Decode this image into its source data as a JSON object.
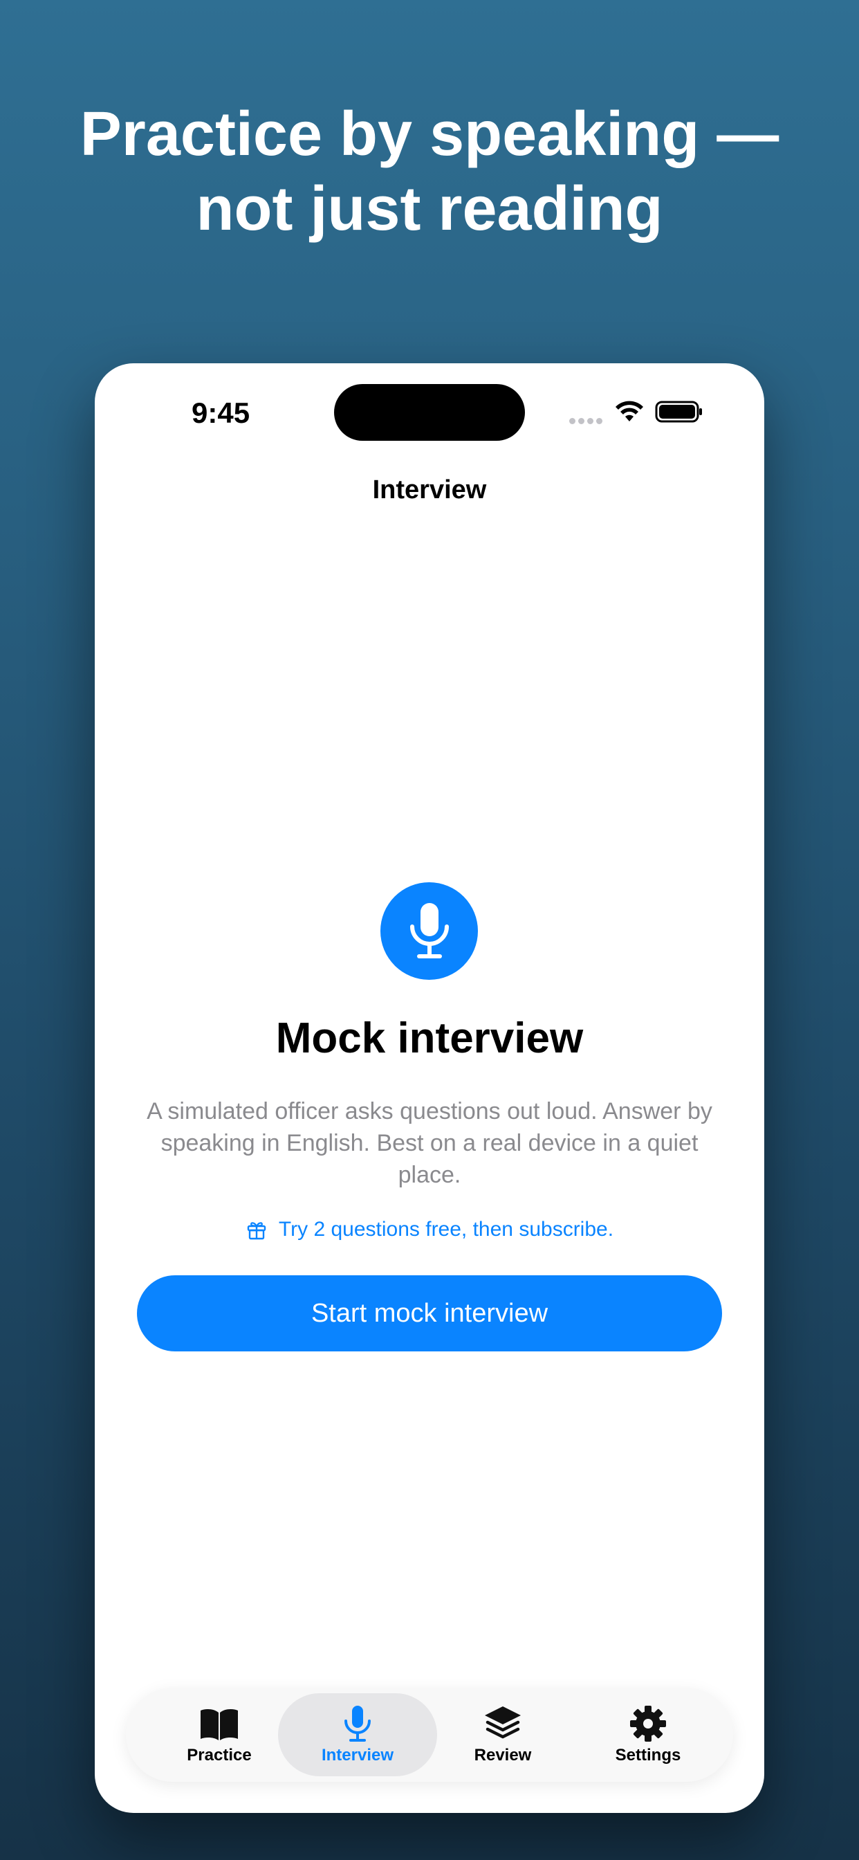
{
  "headline": {
    "line1": "Practice by speaking —",
    "line2": "not just reading"
  },
  "status_bar": {
    "time": "9:45"
  },
  "nav": {
    "title": "Interview"
  },
  "card": {
    "title": "Mock interview",
    "description": "A simulated officer asks questions out loud. Answer by speaking in English. Best on a real device in a quiet place.",
    "free_trial": "Try 2 questions free, then subscribe.",
    "button_label": "Start mock interview"
  },
  "tabs": [
    {
      "label": "Practice",
      "icon": "book-icon",
      "active": false
    },
    {
      "label": "Interview",
      "icon": "microphone-icon",
      "active": true
    },
    {
      "label": "Review",
      "icon": "layers-icon",
      "active": false
    },
    {
      "label": "Settings",
      "icon": "gear-icon",
      "active": false
    }
  ],
  "colors": {
    "accent": "#0a84ff",
    "background_top": "#2f6f93",
    "background_bottom": "#163247"
  }
}
